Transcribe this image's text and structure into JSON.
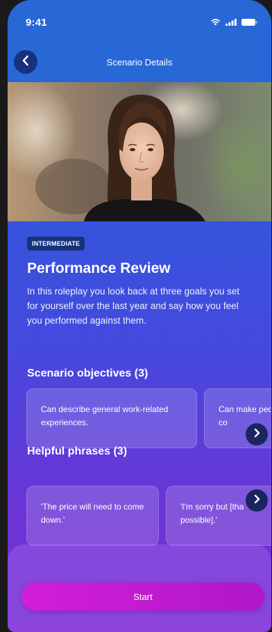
{
  "status_bar": {
    "time": "9:41",
    "icons": [
      "wifi-icon",
      "signal-icon",
      "battery-icon"
    ]
  },
  "header": {
    "title": "Scenario Details",
    "back_icon": "chevron-left-icon"
  },
  "scenario": {
    "level": "INTERMEDIATE",
    "title": "Performance Review",
    "description": "In this roleplay you look back at three goals you set for yourself over the last year and say how you feel you performed against them."
  },
  "objectives": {
    "title": "Scenario objectives (3)",
    "items": [
      "Can describe general work-related experiences.",
      "Can make people, co"
    ]
  },
  "phrases": {
    "title": "Helpful phrases (3)",
    "items": [
      "'The price will need to come down.'",
      "'I'm sorry but [tha possible].'"
    ]
  },
  "actions": {
    "start_label": "Start"
  },
  "colors": {
    "header": "#2867d6",
    "badge": "#17327c",
    "start_button": "#d21fd8",
    "gradient_bottom": "#7b2bd0"
  }
}
